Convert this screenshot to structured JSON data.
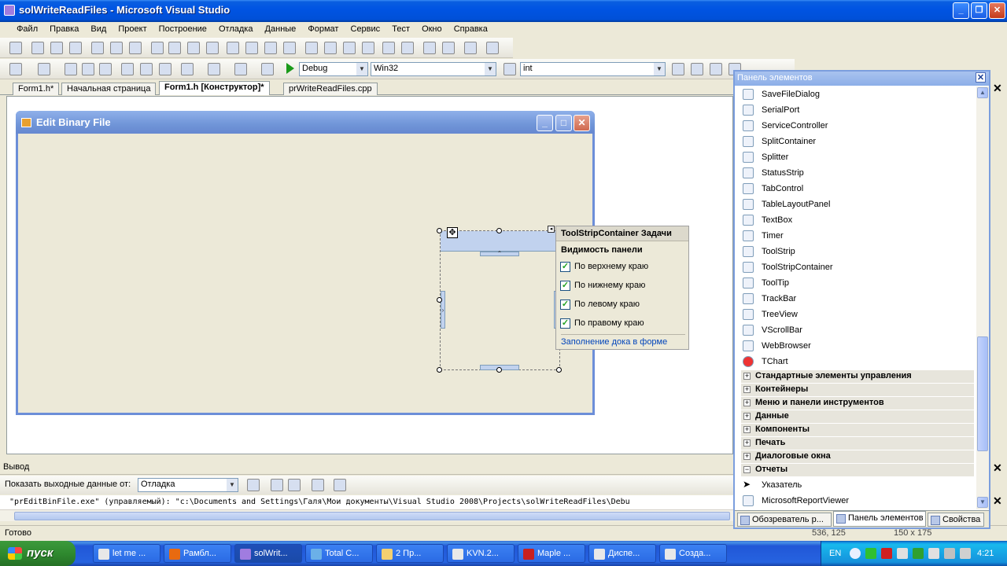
{
  "window": {
    "title": "solWriteReadFiles - Microsoft Visual Studio"
  },
  "menu": [
    "Файл",
    "Правка",
    "Вид",
    "Проект",
    "Построение",
    "Отладка",
    "Данные",
    "Формат",
    "Сервис",
    "Тест",
    "Окно",
    "Справка"
  ],
  "toolbar": {
    "config": "Debug",
    "platform": "Win32",
    "find": "int"
  },
  "doc_tabs": [
    "Form1.h*",
    "Начальная страница",
    "Form1.h [Конструктор]*",
    "prWriteReadFiles.cpp"
  ],
  "form": {
    "title": "Edit Binary File"
  },
  "smart_tag": {
    "title": "ToolStripContainer Задачи",
    "subtitle": "Видимость панели",
    "options": [
      "По верхнему краю",
      "По нижнему краю",
      "По левому краю",
      "По правому краю"
    ],
    "link": "Заполнение дока в форме"
  },
  "output": {
    "title": "Вывод",
    "source_label": "Показать выходные данные от:",
    "source_value": "Отладка",
    "line": "\"prEditBinFile.exe\" (управляемый): \"c:\\Documents and Settings\\Галя\\Мои документы\\Visual Studio 2008\\Projects\\solWriteReadFiles\\Debu"
  },
  "status": {
    "text": "Готово",
    "position": "536, 125",
    "size": "150 x 175"
  },
  "toolbox": {
    "title": "Панель элементов",
    "items": [
      "SaveFileDialog",
      "SerialPort",
      "ServiceController",
      "SplitContainer",
      "Splitter",
      "StatusStrip",
      "TabControl",
      "TableLayoutPanel",
      "TextBox",
      "Timer",
      "ToolStrip",
      "ToolStripContainer",
      "ToolTip",
      "TrackBar",
      "TreeView",
      "VScrollBar",
      "WebBrowser",
      "TChart"
    ],
    "categories": [
      "Стандартные элементы управления",
      "Контейнеры",
      "Меню и панели инструментов",
      "Данные",
      "Компоненты",
      "Печать",
      "Диалоговые окна",
      "Отчеты"
    ],
    "report_items": [
      "Указатель",
      "MicrosoftReportViewer"
    ],
    "tabs": [
      "Обозреватель р...",
      "Панель элементов",
      "Свойства"
    ]
  },
  "taskbar": {
    "start": "пуск",
    "tasks": [
      "let me ...",
      "Рамбл...",
      "solWrit...",
      "Total C...",
      "2 Пр...",
      "KVN.2...",
      "Maple ...",
      "Диспе...",
      "Созда..."
    ],
    "lang": "EN",
    "clock": "4:21"
  }
}
